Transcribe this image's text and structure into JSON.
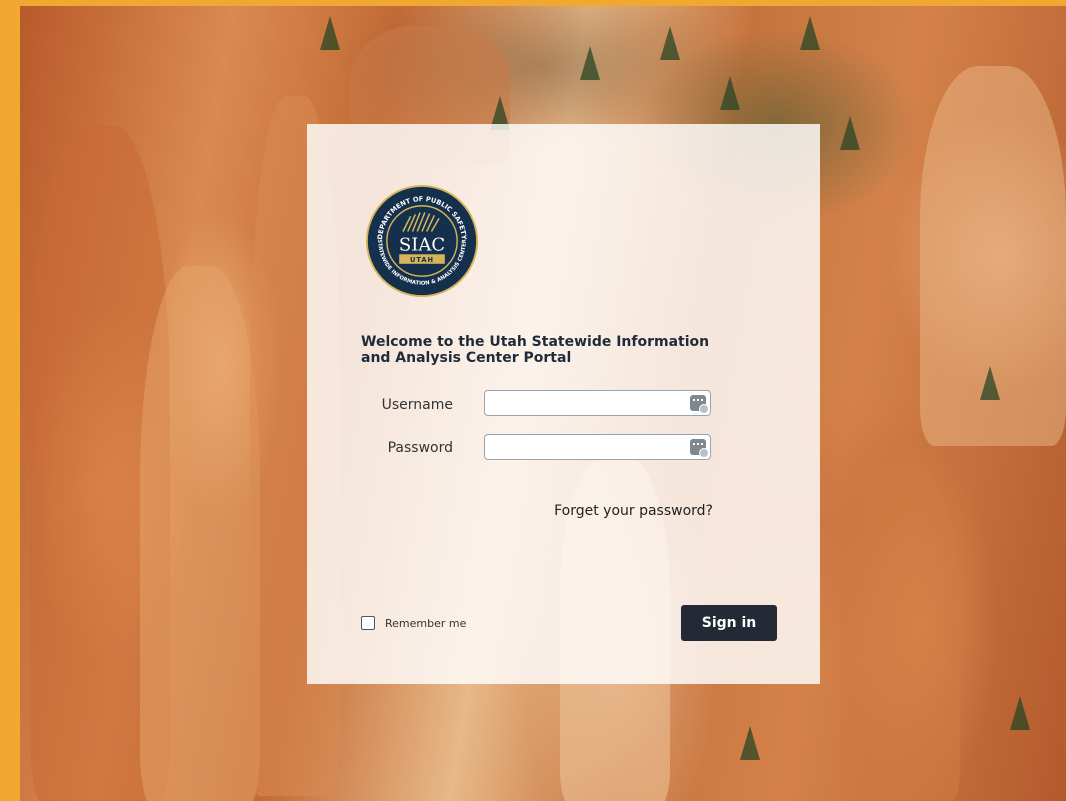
{
  "logo": {
    "ring_top_text": "DEPARTMENT OF PUBLIC SAFETY",
    "ring_bottom_text": "STATEWIDE INFORMATION & ANALYSIS CENTER",
    "acronym": "SIAC",
    "state": "UTAH",
    "colors": {
      "navy": "#14304d",
      "gold": "#d6b45a"
    }
  },
  "welcome_text": "Welcome to the Utah Statewide Information and Analysis Center Portal",
  "form": {
    "username_label": "Username",
    "username_value": "",
    "password_label": "Password",
    "password_value": "",
    "forgot_link": "Forget your password?",
    "remember_label": "Remember me",
    "remember_checked": false,
    "signin_label": "Sign in",
    "key_icon": "password-manager-key-icon"
  },
  "colors": {
    "frame": "#f0a830",
    "button": "#232a35",
    "card": "rgba(255,255,255,0.82)"
  }
}
